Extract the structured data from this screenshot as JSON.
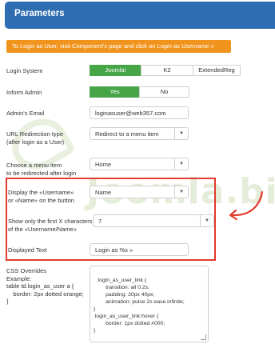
{
  "header": {
    "title": "Parameters"
  },
  "notice": {
    "text_before": "To Login as User, visit Component's page and click on ",
    "text_em": "Login as Username",
    "text_after": " »"
  },
  "login_system": {
    "label": "Login System",
    "options": [
      "Joomla!",
      "K2",
      "ExtendedReg"
    ],
    "selected": "Joomla!"
  },
  "inform_admin": {
    "label": "Inform Admin",
    "options": [
      "Yes",
      "No"
    ],
    "selected": "Yes"
  },
  "admin_email": {
    "label": "Admin's Email",
    "value": "loginasuser@web357.com"
  },
  "url_redirection": {
    "label_line1": "URL Redirection type",
    "label_line2": "(after login as a User)",
    "value": "Redirect to a menu item"
  },
  "menu_item": {
    "label_line1": "Choose a menu item",
    "label_line2": "to be redirected after login",
    "value": "Home"
  },
  "display_username": {
    "label_line1": "Display the «Username»",
    "label_line2": "or «Name» on the button",
    "value": "Name"
  },
  "first_chars": {
    "label_line1": "Show only the first X characters",
    "label_line2": "of the «Username/Name»",
    "value": "7"
  },
  "displayed_text": {
    "label": "Displayed Text",
    "value": "Login as %s »"
  },
  "css_overrides": {
    "label_lines": "CSS Overrides\nExample:\ntable td.login_as_user a {\n    border: 2px dotted orange;\n}",
    "value": ".login_as_user_link {\n        transition: all 0.2s;\n        padding: 20px 40px;\n        animation: pulse 2s ease infinite;\n}\n.login_as_user_link:hover {\n        border: 1px dotted #000;\n}"
  },
  "colors": {
    "header_bg": "#2f6db3",
    "notice_bg": "#f0941e",
    "active_toggle": "#46a546",
    "highlight": "#e53a2e"
  }
}
